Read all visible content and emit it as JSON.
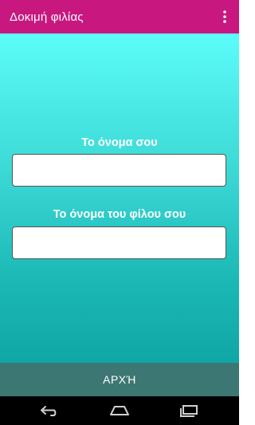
{
  "app_bar": {
    "title": "Δοκιμή φιλίας",
    "background": "#c8187f",
    "overflow_icon": "overflow-menu-icon"
  },
  "form": {
    "name_label": "Το όνομα σου",
    "name_value": "",
    "friend_label": "Το όνομα του φίλου σου",
    "friend_value": ""
  },
  "start_button": {
    "label": "ΑΡΧΉ",
    "background": "#3d7774"
  },
  "nav_bar": {
    "buttons": [
      "back-icon",
      "home-icon",
      "recents-icon"
    ]
  }
}
